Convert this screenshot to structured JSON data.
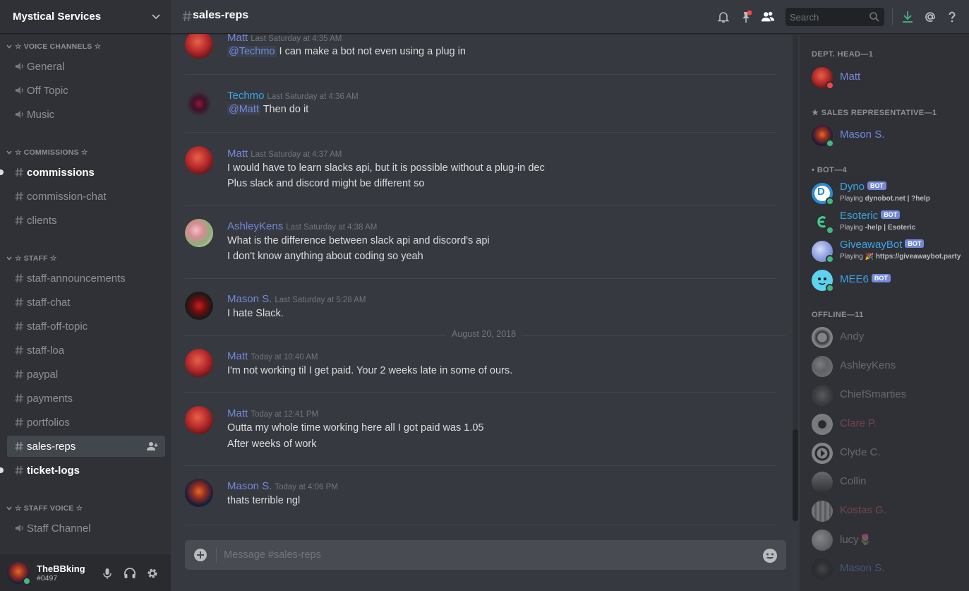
{
  "server": {
    "name": "Mystical Services"
  },
  "categories": {
    "voice": "☆ VOICE CHANNELS ☆",
    "commissions": "☆ COMMISSIONS ☆",
    "staff": "☆ STAFF ☆",
    "staff_voice": "☆ STAFF VOICE ☆"
  },
  "channels": {
    "voice": [
      "General",
      "Off Topic",
      "Music"
    ],
    "commissions": [
      "commissions",
      "commission-chat",
      "clients"
    ],
    "staff": [
      "staff-announcements",
      "staff-chat",
      "staff-off-topic",
      "staff-loa",
      "paypal",
      "payments",
      "portfolios",
      "sales-reps",
      "ticket-logs"
    ],
    "staff_voice": [
      "Staff Channel"
    ]
  },
  "user": {
    "name": "TheBBking",
    "discriminator": "#0497"
  },
  "header": {
    "channel": "sales-reps",
    "search_placeholder": "Search"
  },
  "messages": [
    {
      "author": "Matt",
      "color": "#7289da",
      "time": "Last Saturday at 4:35 AM",
      "mention": "@Techmo",
      "lines": [
        "I can make a bot not even using a plug in"
      ]
    },
    {
      "author": "Techmo",
      "color": "#3ca4e6",
      "time": "Last Saturday at 4:36 AM",
      "mention": "@Matt",
      "lines": [
        "Then  do it"
      ]
    },
    {
      "author": "Matt",
      "color": "#7289da",
      "time": "Last Saturday at 4:37 AM",
      "lines": [
        "I would have to learn slacks api, but it is possible without a plug-in dec",
        "Plus slack and discord might be different so"
      ]
    },
    {
      "author": "AshleyKens",
      "color": "#7289da",
      "time": "Last Saturday at 4:38 AM",
      "lines": [
        "What is the difference between slack api and discord's api",
        "I don't know anything about coding so yeah"
      ]
    },
    {
      "author": "Mason S.",
      "color": "#7289da",
      "time": "Last Saturday at 5:28 AM",
      "lines": [
        "I hate Slack."
      ]
    },
    {
      "author": "Matt",
      "color": "#7289da",
      "time": "Today at 10:40 AM",
      "lines": [
        "I'm not working til I get paid. Your 2 weeks late in some of ours."
      ]
    },
    {
      "author": "Matt",
      "color": "#7289da",
      "time": "Today at 12:41 PM",
      "lines": [
        "Outta my whole time working here all I got paid was 1.05",
        "After weeks of work"
      ]
    },
    {
      "author": "Mason S.",
      "color": "#7289da",
      "time": "Today at 4:06 PM",
      "lines": [
        "thats terrible ngl"
      ]
    }
  ],
  "date_divider": "August 20, 2018",
  "composer": {
    "placeholder": "Message #sales-reps"
  },
  "member_groups": {
    "dept_head": "DEPT. HEAD—1",
    "sales": "★ SALES REPRESENTATIVE—1",
    "bot": "• BOT—4",
    "offline": "OFFLINE—11"
  },
  "members": {
    "dept_head": [
      {
        "name": "Matt",
        "color": "#7289da",
        "status": "#f04747"
      }
    ],
    "sales": [
      {
        "name": "Mason S.",
        "color": "#7289da",
        "status": "#43b581"
      }
    ],
    "bots": [
      {
        "name": "Dyno",
        "color": "#3ca4e6",
        "tag": "BOT",
        "playing": "Playing",
        "game": "dynobot.net | ?help"
      },
      {
        "name": "Esoteric",
        "color": "#3ca4e6",
        "tag": "BOT",
        "playing": "Playing",
        "game": "-help | Esoteric"
      },
      {
        "name": "GiveawayBot",
        "color": "#3ca4e6",
        "tag": "BOT",
        "playing": "Playing",
        "game": "🎉 https://giveawaybot.party"
      },
      {
        "name": "MEE6",
        "color": "#3ca4e6",
        "tag": "BOT"
      }
    ],
    "offline": [
      {
        "name": "Andy",
        "color": "#b9bbbe"
      },
      {
        "name": "AshleyKens",
        "color": "#b9bbbe"
      },
      {
        "name": "ChiefSmarties",
        "color": "#b9bbbe"
      },
      {
        "name": "Clare P.",
        "color": "#e06070"
      },
      {
        "name": "Clyde C.",
        "color": "#b9bbbe"
      },
      {
        "name": "Collin",
        "color": "#b9bbbe"
      },
      {
        "name": "Kostas G.",
        "color": "#b9bbbe"
      },
      {
        "name": "lucy🌷",
        "color": "#b9bbbe"
      },
      {
        "name": "Mason S.",
        "color": "#7289da"
      }
    ]
  }
}
